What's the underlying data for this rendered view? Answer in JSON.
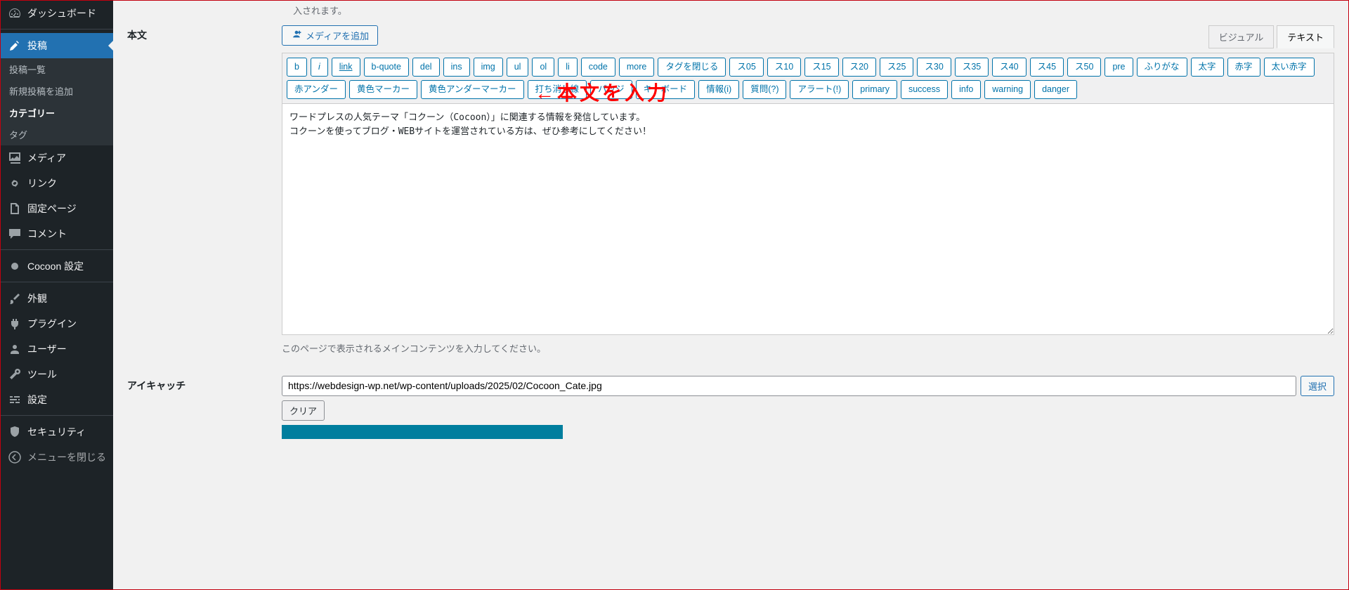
{
  "truncatedTop": "入されます。",
  "sidebar": {
    "dashboard": "ダッシュボード",
    "posts": "投稿",
    "postsSub": {
      "list": "投稿一覧",
      "new": "新規投稿を追加",
      "category": "カテゴリー",
      "tag": "タグ"
    },
    "media": "メディア",
    "links": "リンク",
    "pages": "固定ページ",
    "comments": "コメント",
    "cocoon": "Cocoon 設定",
    "appearance": "外観",
    "plugins": "プラグイン",
    "users": "ユーザー",
    "tools": "ツール",
    "settings": "設定",
    "security": "セキュリティ",
    "collapse": "メニューを閉じる"
  },
  "editor": {
    "label": "本文",
    "addMedia": "メディアを追加",
    "tabVisual": "ビジュアル",
    "tabText": "テキスト",
    "buttons": [
      "b",
      "i",
      "link",
      "b-quote",
      "del",
      "ins",
      "img",
      "ul",
      "ol",
      "li",
      "code",
      "more",
      "タグを閉じる",
      "ス05",
      "ス10",
      "ス15",
      "ス20",
      "ス25",
      "ス30",
      "ス35",
      "ス40",
      "ス45",
      "ス50",
      "pre",
      "ふりがな",
      "太字",
      "赤字",
      "太い赤字",
      "赤アンダー",
      "黄色マーカー",
      "黄色アンダーマーカー",
      "打ち消し線",
      "バッジ",
      "キーボード",
      "情報(i)",
      "質問(?)",
      "アラート(!)",
      "primary",
      "success",
      "info",
      "warning",
      "danger"
    ],
    "content": "ワードプレスの人気テーマ「コクーン（Cocoon）」に関連する情報を発信しています。\nコクーンを使ってブログ・WEBサイトを運営されている方は、ぜひ参考にしてください！",
    "description": "このページで表示されるメインコンテンツを入力してください。",
    "annotation": "←本文を入力"
  },
  "eyecatch": {
    "label": "アイキャッチ",
    "url": "https://webdesign-wp.net/wp-content/uploads/2025/02/Cocoon_Cate.jpg",
    "select": "選択",
    "clear": "クリア"
  }
}
